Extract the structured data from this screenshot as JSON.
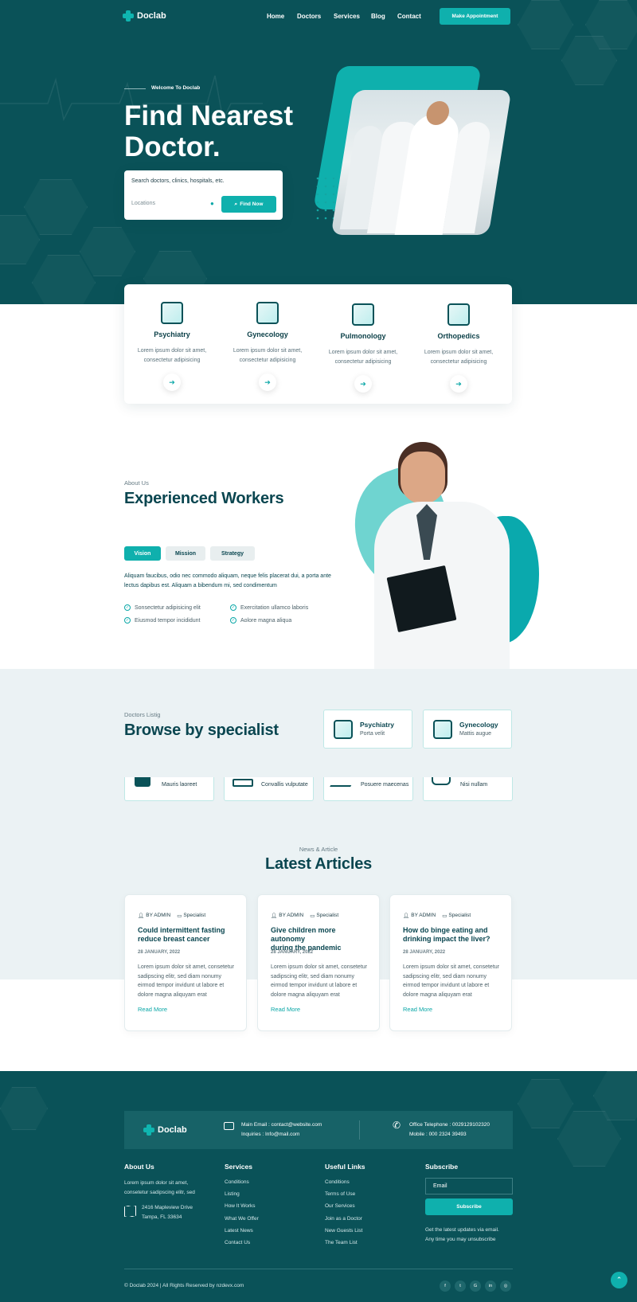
{
  "nav": {
    "brand": "Doclab",
    "links": [
      "Home",
      "Doctors",
      "Services",
      "Blog",
      "Contact"
    ],
    "cta": "Make Appointment"
  },
  "hero": {
    "eyebrow": "Welcome To Doclab",
    "title_line1": "Find Nearest",
    "title_line2": "Doctor.",
    "search_placeholder": "Search doctors, clinics, hospitals, etc.",
    "location_placeholder": "Locations",
    "find_label": "Find Now"
  },
  "services": [
    {
      "name": "Psychiatry",
      "desc1": "Lorem ipsum dolor sit amet,",
      "desc2": "consectetur adipisicing"
    },
    {
      "name": "Gynecology",
      "desc1": "Lorem ipsum dolor sit amet,",
      "desc2": "consectetur adipisicing"
    },
    {
      "name": "Pulmonology",
      "desc1": "Lorem ipsum dolor sit amet,",
      "desc2": "consectetur adipisicing"
    },
    {
      "name": "Orthopedics",
      "desc1": "Lorem ipsum dolor sit amet,",
      "desc2": "consectetur adipisicing"
    }
  ],
  "about": {
    "label": "About Us",
    "title": "Experienced Workers",
    "tabs": [
      "Vision",
      "Mission",
      "Strategy"
    ],
    "text1": "Aliquam faucibus, odio nec commodo aliquam, neque felis placerat dui, a porta ante",
    "text2": "lectus dapibus est. Aliquam a bibendum mi, sed condimentum",
    "checks": [
      "Sonsectetur adipisicing elit",
      "Exercitation ullamco laboris",
      "Eiusmod tempor incididunt",
      "Aolore magna aliqua"
    ]
  },
  "specialist": {
    "label": "Doctors Listig",
    "title": "Browse by specialist",
    "top": [
      {
        "name": "Psychiatry",
        "sub": "Porta velit"
      },
      {
        "name": "Gynecology",
        "sub": "Mattis augue"
      }
    ],
    "bottom": [
      "Mauris laoreet",
      "Convallis vulputate",
      "Posuere maecenas",
      "Nisi nullam"
    ]
  },
  "articles": {
    "label": "News & Article",
    "title": "Latest Articles",
    "author": "BY ADMIN",
    "category": "Specialist",
    "read_more": "Read More",
    "items": [
      {
        "title1": "Could intermittent fasting",
        "title2": "reduce breast cancer",
        "date": "28 JANUARY, 2022",
        "p1": "Lorem ipsum dolor sit amet, consetetur",
        "p2": "sadipscing elitr, sed diam nonumy",
        "p3": "eirmod tempor invidunt ut labore et",
        "p4": "dolore magna aliquyam erat"
      },
      {
        "title1": "Give children more autonomy",
        "title2": "during the pandemic",
        "date": "28 JANUARY, 2022",
        "p1": "Lorem ipsum dolor sit amet, consetetur",
        "p2": "sadipscing elitr, sed diam nonumy",
        "p3": "eirmod tempor invidunt ut labore et",
        "p4": "dolore magna aliquyam erat"
      },
      {
        "title1": "How do binge eating and",
        "title2": "drinking impact the liver?",
        "date": "28 JANUARY, 2022",
        "p1": "Lorem ipsum dolor sit amet, consetetur",
        "p2": "sadipscing elitr, sed diam nonumy",
        "p3": "eirmod tempor invidunt ut labore et",
        "p4": "dolore magna aliquyam erat"
      }
    ]
  },
  "footer": {
    "brand": "Doclab",
    "email_line1": "Main Email : contact@website.com",
    "email_line2": "Inquiries : Info@mail.com",
    "phone_line1": "Office Telephone : 0029129102320",
    "phone_line2": "Mobile : 000 2324 39493",
    "about_title": "About Us",
    "about_text1": "Lorem ipsum dolor sit amet,",
    "about_text2": "consetetur sadipscing elitr, sed",
    "address1": "2416 Mapleview Drive",
    "address2": "Tampa, FL 33634",
    "services_title": "Services",
    "services": [
      "Conditions",
      "Listing",
      "How It Works",
      "What We Offer",
      "Latest News",
      "Contact Us"
    ],
    "links_title": "Useful Links",
    "links": [
      "Conditions",
      "Terms of Use",
      "Our Services",
      "Join as a Doctor",
      "New Guests List",
      "The Team List"
    ],
    "subscribe_title": "Subscribe",
    "email_placeholder": "Email",
    "subscribe_button": "Subscribe",
    "subscribe_note1": "Get the latest updates via email.",
    "subscribe_note2": "Any time you may unsubscribe",
    "copyright": "© Doclab 2024 | All Rights Reserved by nzdevx.com",
    "social": [
      "f",
      "t",
      "G",
      "in",
      "◎"
    ]
  },
  "colors": {
    "primary": "#0a5258",
    "accent": "#0fb0ad",
    "light_bg": "#ebf2f4"
  }
}
